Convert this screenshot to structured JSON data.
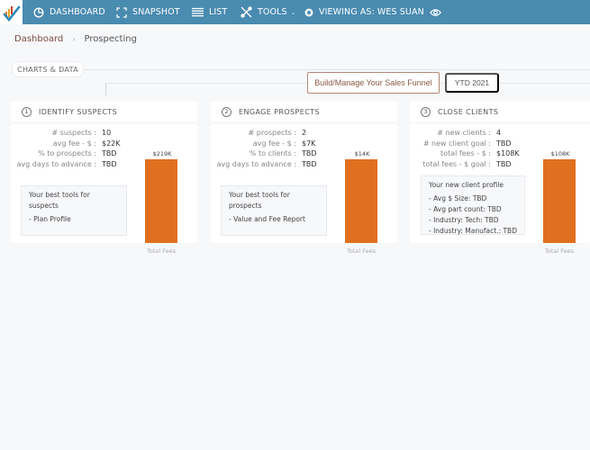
{
  "nav": {
    "items": [
      {
        "label": "DASHBOARD",
        "icon": "pie-chart-icon"
      },
      {
        "label": "SNAPSHOT",
        "icon": "frame-corners-icon"
      },
      {
        "label": "LIST",
        "icon": "list-lines-icon"
      },
      {
        "label": "TOOLS",
        "icon": "tools-icon",
        "has_dropdown": true
      },
      {
        "label": "VIEWING AS: WES SUAN",
        "icon": "user-circle-icon",
        "trailing_icon": "eye-icon"
      }
    ],
    "tools_caret": "⌄",
    "colors": {
      "bar": "#4a8bb0"
    }
  },
  "breadcrumb": {
    "root": "Dashboard",
    "separator": "›",
    "current": "Prospecting"
  },
  "section_label": "CHARTS & DATA",
  "funnel_button": "Build/Manage Your Sales Funnel",
  "period_button": "YTD 2021",
  "cards": [
    {
      "number": "1",
      "title": "IDENTIFY SUSPECTS",
      "stats": [
        {
          "label": "# suspects :",
          "value": "10"
        },
        {
          "label": "avg fee - $ :",
          "value": "$22K"
        },
        {
          "label": "% to prospects :",
          "value": "TBD"
        },
        {
          "label": "avg days to advance :",
          "value": "TBD"
        }
      ],
      "box_title": "Your best tools for suspects",
      "box_items": [
        "- Plan Profile"
      ],
      "bar_value_label": "$219K",
      "bar_value": 219,
      "bar_axis_label": "Total Fees"
    },
    {
      "number": "2",
      "title": "ENGAGE PROSPECTS",
      "stats": [
        {
          "label": "# prospects :",
          "value": "2"
        },
        {
          "label": "avg fee - $ :",
          "value": "$7K"
        },
        {
          "label": "% to clients :",
          "value": "TBD"
        },
        {
          "label": "avg days to advance :",
          "value": "TBD"
        }
      ],
      "box_title": "Your best tools for prospects",
      "box_items": [
        "- Value and Fee Report"
      ],
      "bar_value_label": "$14K",
      "bar_value": 14,
      "bar_axis_label": "Total Fees"
    },
    {
      "number": "3",
      "title": "CLOSE CLIENTS",
      "stats": [
        {
          "label": "# new clients :",
          "value": "4"
        },
        {
          "label": "# new client goal :",
          "value": "TBD"
        },
        {
          "label": "total fees - $ :",
          "value": "$108K"
        },
        {
          "label": "total fees - $ goal :",
          "value": "TBD"
        }
      ],
      "box_title": "Your new client profile",
      "box_items": [
        "- Avg $ Size: TBD",
        "- Avg part count: TBD",
        "- Industry: Tech: TBD",
        "- Industry: Manufact.: TBD"
      ],
      "bar_value_label": "$108K",
      "bar_value": 108,
      "bar_axis_label": "Total Fees"
    }
  ],
  "colors": {
    "bar_fill": "#e07020",
    "accent_brown": "#8a5a44"
  }
}
